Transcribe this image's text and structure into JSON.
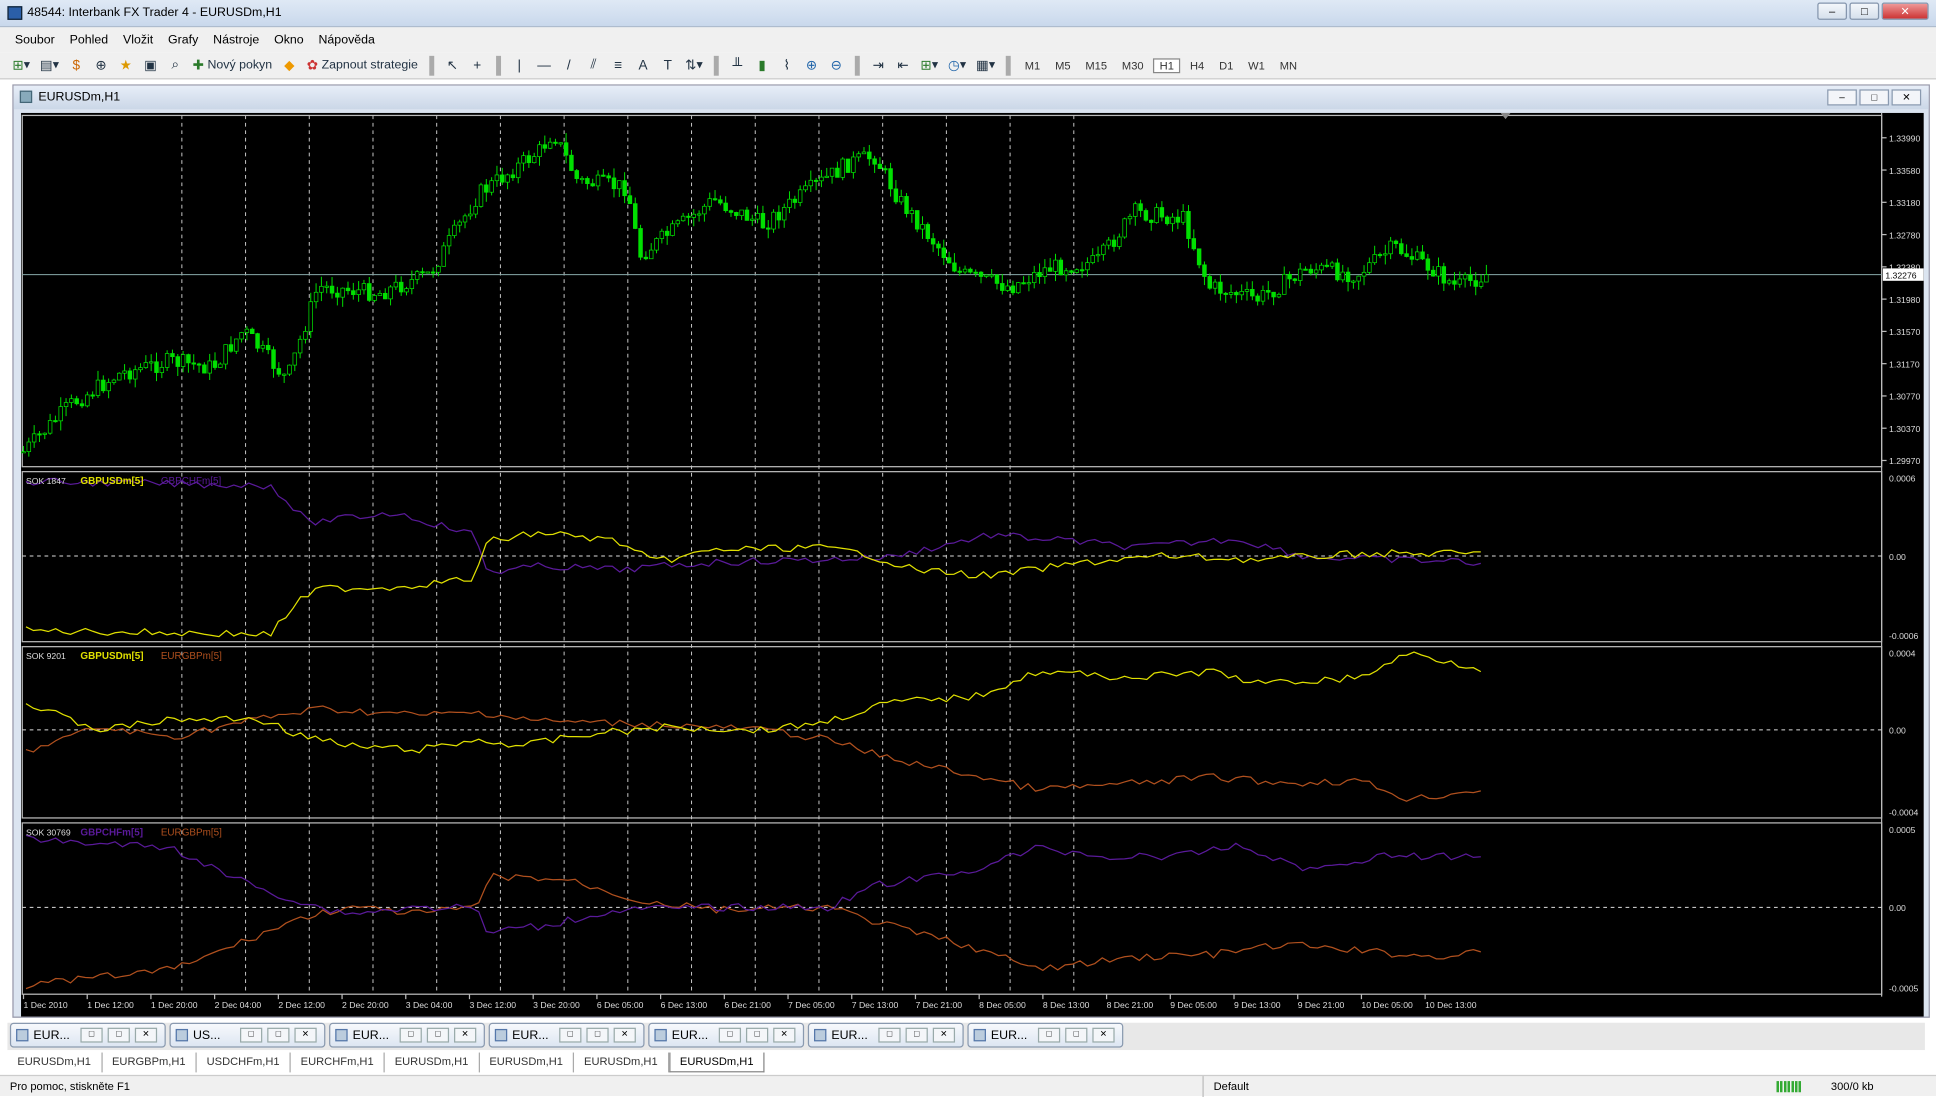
{
  "app": {
    "title": "48544: Interbank FX Trader 4 - EURUSDm,H1",
    "window_buttons": [
      "–",
      "□",
      "✕"
    ]
  },
  "menu": [
    "Soubor",
    "Pohled",
    "Vložit",
    "Grafy",
    "Nástroje",
    "Okno",
    "Nápověda"
  ],
  "toolbar": {
    "new_order": "Nový pokyn",
    "strategies": "Zapnout strategie",
    "timeframes": [
      "M1",
      "M5",
      "M15",
      "M30",
      "H1",
      "H4",
      "D1",
      "W1",
      "MN"
    ],
    "active_timeframe": "H1"
  },
  "chart_window": {
    "title": "EURUSDm,H1",
    "price_axis": [
      "1.33990",
      "1.33580",
      "1.33180",
      "1.32780",
      "1.32380",
      "1.31980",
      "1.31570",
      "1.31170",
      "1.30770",
      "1.30370",
      "1.29970"
    ],
    "current_price": "1.32276",
    "time_axis": [
      "1 Dec 2010",
      "1 Dec 12:00",
      "1 Dec 20:00",
      "2 Dec 04:00",
      "2 Dec 12:00",
      "2 Dec 20:00",
      "3 Dec 04:00",
      "3 Dec 12:00",
      "3 Dec 20:00",
      "6 Dec 05:00",
      "6 Dec 13:00",
      "6 Dec 21:00",
      "7 Dec 05:00",
      "7 Dec 13:00",
      "7 Dec 21:00",
      "8 Dec 05:00",
      "8 Dec 13:00",
      "8 Dec 21:00",
      "9 Dec 05:00",
      "9 Dec 13:00",
      "9 Dec 21:00",
      "10 Dec 05:00",
      "10 Dec 13:00"
    ],
    "panels": [
      {
        "id": "SOK 1847",
        "s1": "GBPUSDm[5]",
        "s2": "GBPCHFm[5]",
        "top": "0.0006",
        "mid": "0.00",
        "bot": "-0.0006"
      },
      {
        "id": "SOK 9201",
        "s1": "GBPUSDm[5]",
        "s2": "EURGBPm[5]",
        "top": "0.0004",
        "mid": "0.00",
        "bot": "-0.0004"
      },
      {
        "id": "SOK 30769",
        "s1": "GBPCHFm[5]",
        "s2": "EURGBPm[5]",
        "top": "0.0005",
        "mid": "0.00",
        "bot": "-0.0005"
      }
    ]
  },
  "colors": {
    "bull": "#00e000",
    "gbpusd": "#e0e000",
    "gbpchf": "#5a1a9a",
    "eurgbp": "#b0501e",
    "bg": "#000000",
    "grid": "#c8c8c8"
  },
  "window_tabs": [
    "EUR...",
    "US...",
    "EUR...",
    "EUR...",
    "EUR...",
    "EUR...",
    "EUR..."
  ],
  "chart_tabs": [
    "EURUSDm,H1",
    "EURGBPm,H1",
    "USDCHFm,H1",
    "EURCHFm,H1",
    "EURUSDm,H1",
    "EURUSDm,H1",
    "EURUSDm,H1",
    "EURUSDm,H1"
  ],
  "active_chart_tab": 7,
  "status": {
    "help": "Pro pomoc, stiskněte F1",
    "profile": "Default",
    "traffic": "300/0 kb"
  }
}
